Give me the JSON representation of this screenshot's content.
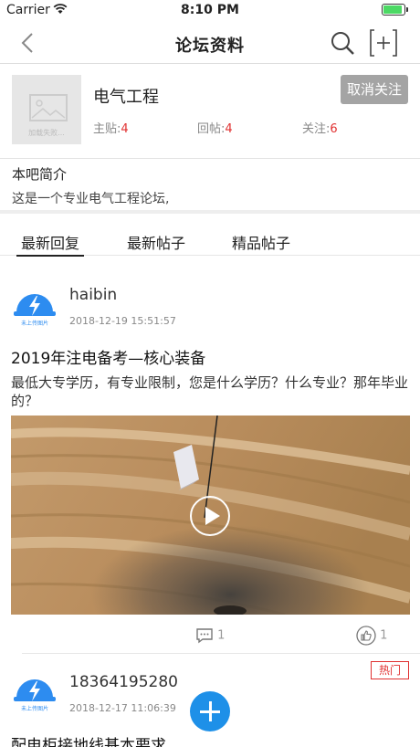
{
  "status_bar": {
    "carrier": "Carrier",
    "time": "8:10 PM",
    "battery_level": 0.95
  },
  "nav": {
    "title": "论坛资料",
    "icons": [
      "back-chevron-icon",
      "search-icon",
      "add-forum-icon"
    ]
  },
  "forum": {
    "name": "电气工程",
    "thumb_placeholder": "加载失败...",
    "unfollow_label": "取消关注",
    "stats": [
      {
        "label": "主贴:",
        "value": "4"
      },
      {
        "label": "回帖:",
        "value": "4"
      },
      {
        "label": "关注:",
        "value": "6"
      }
    ]
  },
  "intro": {
    "title": "本吧简介",
    "text": "这是一个专业电气工程论坛,"
  },
  "tabs": [
    {
      "label": "最新回复",
      "active": true
    },
    {
      "label": "最新帖子",
      "active": false
    },
    {
      "label": "精品帖子",
      "active": false
    }
  ],
  "avatar_caption": "未上传图片",
  "posts": [
    {
      "author": "haibin",
      "time": "2018-12-19 15:51:57",
      "title": "2019年注电备考—核心装备",
      "body": "最低大专学历，有专业限制，您是什么学历？什么专业？那年毕业的？",
      "comments": "1",
      "likes": "1"
    },
    {
      "author": "18364195280",
      "time": "2018-12-17 11:06:39",
      "title": "配电柜接地线基本要求",
      "badge": "热门"
    }
  ],
  "colors": {
    "accent": "#1e90e8",
    "stat_number": "#e03030",
    "hot_badge": "#e03030",
    "unfollow_bg": "#a4a4a4"
  }
}
